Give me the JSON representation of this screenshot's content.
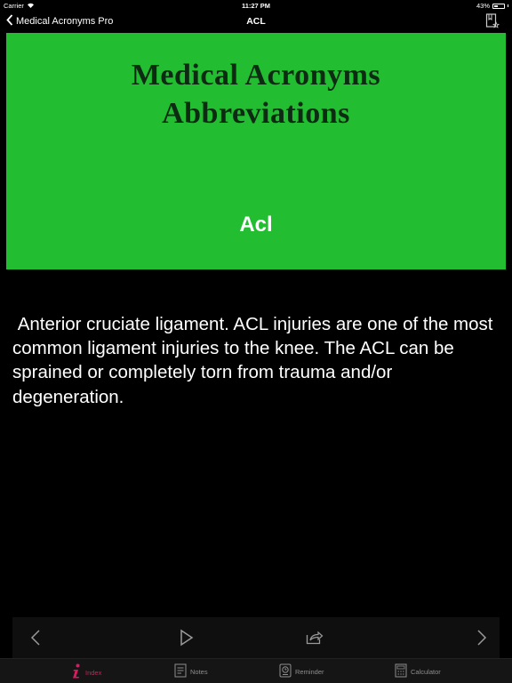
{
  "status": {
    "carrier": "Carrier",
    "time": "11:27 PM",
    "battery": "43%",
    "battery_level": 0.43
  },
  "nav": {
    "back_label": "Medical Acronyms Pro",
    "title": "ACL"
  },
  "banner": {
    "line1": "Medical Acronyms",
    "line2": "Abbreviations",
    "term": "Acl"
  },
  "definition": " Anterior cruciate ligament. ACL injuries are one of the most common ligament injuries to the knee. The ACL can be sprained or completely torn from trauma and/or degeneration.",
  "tabs": [
    {
      "label": "Index",
      "icon": "info-icon",
      "active": true
    },
    {
      "label": "Notes",
      "icon": "notes-icon",
      "active": false
    },
    {
      "label": "Reminder",
      "icon": "reminder-icon",
      "active": false
    },
    {
      "label": "Calculator",
      "icon": "calculator-icon",
      "active": false
    }
  ],
  "colors": {
    "banner_bg": "#22bd31",
    "active_tab": "#d81b60"
  }
}
